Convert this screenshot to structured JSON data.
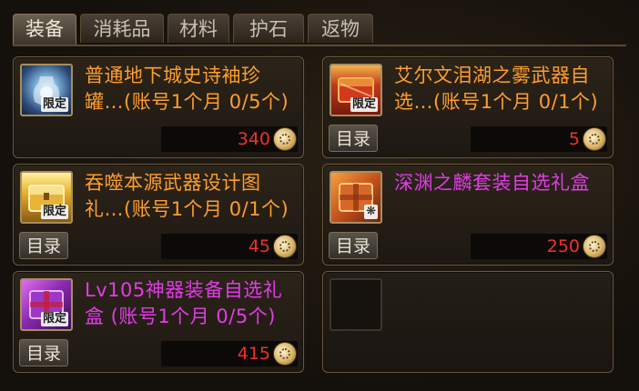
{
  "tabs": [
    {
      "label": "装备",
      "active": true
    },
    {
      "label": "消耗品",
      "active": false
    },
    {
      "label": "材料",
      "active": false
    },
    {
      "label": "护石",
      "active": false
    },
    {
      "label": "返物",
      "active": false
    }
  ],
  "items": [
    {
      "name_line1": "普通地下城史诗袖珍",
      "name_line2": "罐…(账号1个月 0/5个)",
      "name_color": "orange",
      "badge": "限定",
      "catalog_label": "",
      "price": "340",
      "icon": "blue-crystal-jar-icon"
    },
    {
      "name_line1": "艾尔文泪湖之雾武器自",
      "name_line2": "选…(账号1个月 0/1个)",
      "name_color": "orange",
      "badge": "限定",
      "catalog_label": "目录",
      "price": "5",
      "icon": "red-treasure-chest-icon"
    },
    {
      "name_line1": "吞噬本源武器设计图",
      "name_line2": "礼…(账号1个月 0/1个)",
      "name_color": "orange",
      "badge": "限定",
      "catalog_label": "目录",
      "price": "45",
      "icon": "golden-chest-icon"
    },
    {
      "name_line1": "深渊之麟套装自选礼盒",
      "name_line2": "",
      "name_color": "purple",
      "badge": "❋",
      "catalog_label": "目录",
      "price": "250",
      "icon": "orange-gift-box-icon"
    },
    {
      "name_line1": "Lv105神器装备自选礼",
      "name_line2": "盒 (账号1个月 0/5个)",
      "name_color": "purple",
      "badge": "限定",
      "catalog_label": "目录",
      "price": "415",
      "icon": "purple-gift-box-icon"
    }
  ],
  "colors": {
    "orange_name": "#ff9d2e",
    "purple_name": "#e03ce6",
    "price": "#f0312a"
  }
}
